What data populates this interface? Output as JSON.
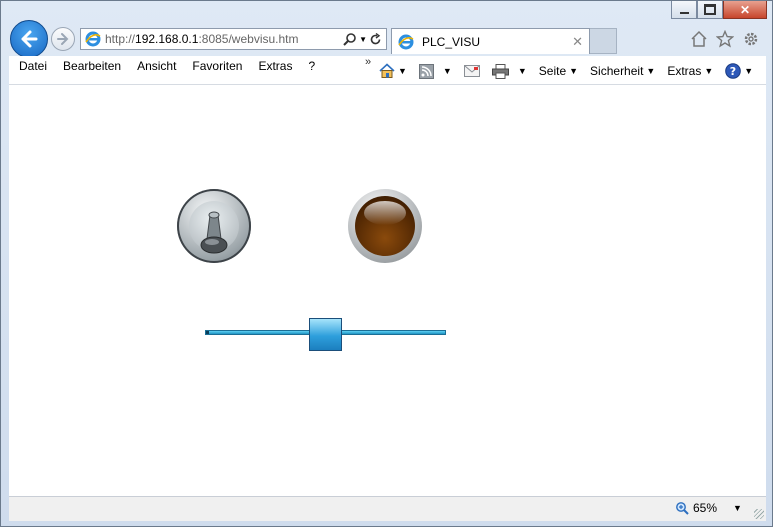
{
  "window": {
    "min_label": "minimize",
    "max_label": "maximize",
    "close_label": "close"
  },
  "nav": {
    "url_prefix": "http://",
    "url_host": "192.168.0.1",
    "url_rest": ":8085/webvisu.htm"
  },
  "tab": {
    "title": "PLC_VISU",
    "close": "✕"
  },
  "menu": {
    "items": [
      "Datei",
      "Bearbeiten",
      "Ansicht",
      "Favoriten",
      "Extras",
      "?"
    ],
    "chevron": "»"
  },
  "commandbar": {
    "seite": "Seite",
    "sicherheit": "Sicherheit",
    "extras": "Extras"
  },
  "content": {
    "slider_value": 0.5
  },
  "status": {
    "zoom": "65%"
  }
}
